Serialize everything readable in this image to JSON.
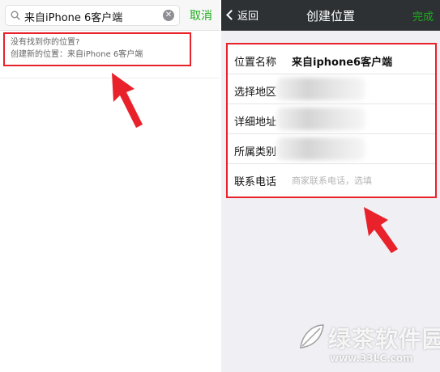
{
  "left_panel": {
    "search": {
      "query": "来自iPhone 6客户端",
      "clear_icon": "clear-icon",
      "cancel_label": "取消"
    },
    "not_found": {
      "line1": "没有找到你的位置?",
      "line2": "创建新的位置：来自iPhone 6客户端"
    }
  },
  "right_panel": {
    "navbar": {
      "back_label": "返回",
      "title": "创建位置",
      "done_label": "完成"
    },
    "form": [
      {
        "label": "位置名称",
        "value": "来自iphone6客户端"
      },
      {
        "label": "选择地区",
        "value": ""
      },
      {
        "label": "详细地址",
        "value": ""
      },
      {
        "label": "所属类别",
        "value": ""
      },
      {
        "label": "联系电话",
        "placeholder": "商家联系电话，选填"
      }
    ]
  },
  "watermark": {
    "brand": "绿茶软件园",
    "url": "www.33LC.com"
  },
  "colors": {
    "annotation_red": "#e8212a",
    "accent_green": "#1aad19",
    "navbar_dark": "#2e3134"
  }
}
